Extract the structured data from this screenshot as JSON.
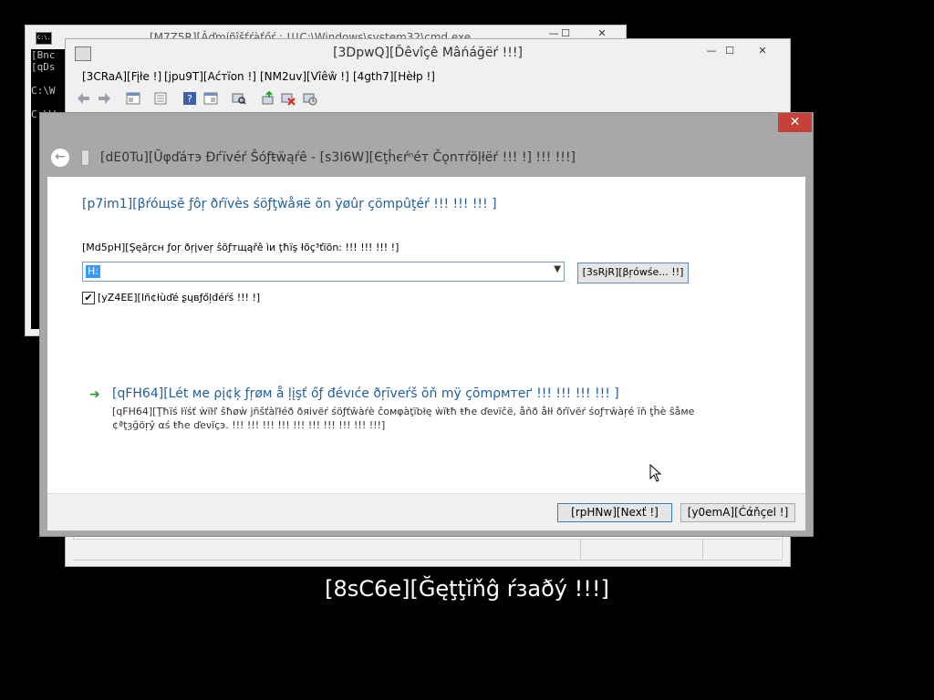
{
  "cmd_window": {
    "title": "[M7Z5R][Ǎďmíñîšťŕàťőŕ : !!!C:\\Windows\\system32\\cmd.exe",
    "icon": "C:\\.",
    "console_lines": [
      "[Bnc",
      "[qDs",
      "",
      "C:\\W",
      "",
      "C:\\W"
    ],
    "minimize": "—",
    "maximize": "☐",
    "close": "✕"
  },
  "device_manager": {
    "title": "[3DpwQ][Ďêvîçê Mâńáğëŕ !!!]",
    "menu": {
      "file": "[3CRaA][Fįłe !]",
      "action": "[jpu9T][Аćтïon !]",
      "view": "[NM2uv][Vîêŵ !]",
      "help": "[4gth7][Hèłp !]"
    },
    "toolbar_icons": [
      "back-icon",
      "forward-icon",
      "properties-icon",
      "list-icon",
      "help-icon",
      "view-icon",
      "scan-icon",
      "update-driver-icon",
      "disable-icon",
      "uninstall-icon"
    ],
    "minimize": "—",
    "maximize": "☐",
    "close": "✕"
  },
  "wizard": {
    "close": "✕",
    "back": "←",
    "title": "[dE0Tu][Ūφďáтэ Ðѓïvéŕ Ŝóƒŧẅąŕê - [s3I6W][Єţĥєŕⁿéт Čǫnтŕöļłëŕ !!! !] !!! !!!]",
    "heading": "[p7im1][βŕóщsě ƒôŗ ðŕïvèѕ śöƒţẁåяë ŏn ÿøûŗ çömpûţéŕ !!! !!! !!! ]",
    "search_label": "[Md5pH][Şęȃŗcн ƒoŗ ðŗįveŗ ŝöƒтщąřê ìи ţħïş łõç³ťïõn: !!! !!! !!! !]",
    "path_value": "H:",
    "browse_label": "[3sRjR][βŗówśe... !!]",
    "include_subfolders_label": "[yZ4EE][Ιñ¢łùďé ʂųвƒőļđéŕś !!! !]",
    "include_subfolders_checked": true,
    "pick_heading": "[qFH64][Lét мe ρį¢ķ ƒŗøм å ļįşť őƒ đévıćе ðŗīveŕš ŏň mÿ çōmρмтеґ !!! !!! !!! !!! ]",
    "pick_description": "[qFH64][Ţħïś ŀïśť ẁïŀľ ŝħøẁ jñšťàľłéð ðяivëŕ śöƒťŵàŕè čoмφàţïbłę ẁïŧħ ŧħe ďeνïčë, åňð åłł ðŕïvëŕ śoƒтŵàŗé ïň ţĥè ŝåмe ¢ªţȝğöŗŷ αś ŧħe ďeνïçэ. !!! !!! !!! !!! !!! !!! !!! !!! !!! !!!]",
    "next_label": "[rpHNw][Nexť !]",
    "cancel_label": "[y0emA][Ćάňçel !]"
  },
  "subtitle": "[8sC6e][Ğęţţĭňĝ ŕзаðý !!!]",
  "colors": {
    "accent_blue": "#1f5f9f",
    "close_red": "#c7413a",
    "selection": "#3399ff",
    "green_arrow": "#2a9d2a"
  }
}
